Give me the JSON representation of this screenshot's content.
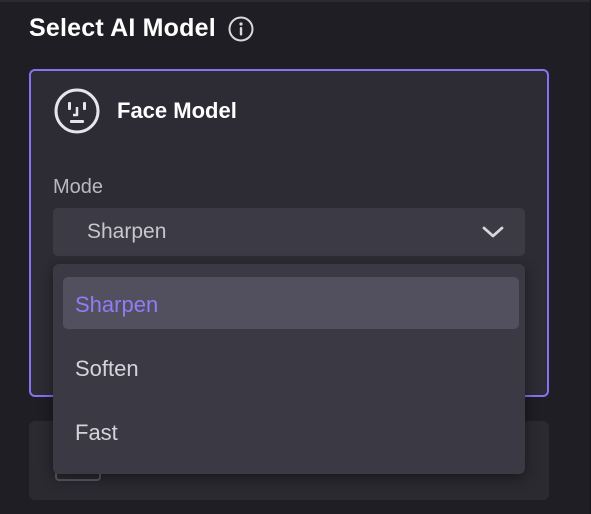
{
  "panel": {
    "title": "Select AI Model",
    "info_icon": "info-circle-icon"
  },
  "face_model_card": {
    "icon": "face-icon",
    "title": "Face Model",
    "selected_border_color": "#8673f2",
    "mode": {
      "label": "Mode",
      "value": "Sharpen",
      "expanded": true
    }
  },
  "dropdown": {
    "options": [
      {
        "label": "Sharpen",
        "selected": true
      },
      {
        "label": "Soften",
        "selected": false
      },
      {
        "label": "Fast",
        "selected": false
      }
    ],
    "selected_color": "#8f7df5"
  },
  "second_card": {
    "icon": "model-icon"
  }
}
